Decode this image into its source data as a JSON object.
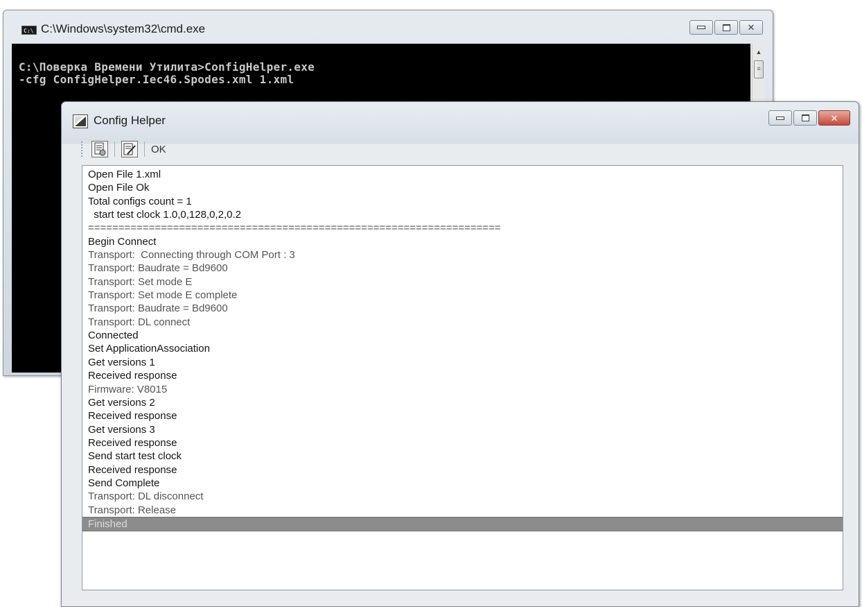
{
  "cmd_window": {
    "title": "C:\\Windows\\system32\\cmd.exe",
    "console_lines": [
      "C:\\Поверка Времени Утилита>ConfigHelper.exe",
      "-cfg ConfigHelper.Iec46.Spodes.xml 1.xml"
    ],
    "icon": "cmd-icon"
  },
  "config_helper": {
    "title": "Config Helper",
    "toolbar": {
      "button1_icon": "document-settings-icon",
      "button2_icon": "document-edit-icon",
      "ok_label": "OK"
    },
    "log": [
      {
        "text": "Open File 1.xml",
        "style": "normal"
      },
      {
        "text": "Open File Ok",
        "style": "normal"
      },
      {
        "text": "Total configs count = 1",
        "style": "normal"
      },
      {
        "text": "  start test clock 1.0,0,128,0,2,0.2",
        "style": "normal"
      },
      {
        "text": "====================================================================",
        "style": "dim"
      },
      {
        "text": "Begin Connect",
        "style": "normal"
      },
      {
        "text": "Transport:  Connecting through COM Port : 3",
        "style": "dim"
      },
      {
        "text": "Transport: Baudrate = Bd9600",
        "style": "dim"
      },
      {
        "text": "Transport: Set mode E",
        "style": "dim"
      },
      {
        "text": "Transport: Set mode E complete",
        "style": "dim"
      },
      {
        "text": "Transport: Baudrate = Bd9600",
        "style": "dim"
      },
      {
        "text": "Transport: DL connect",
        "style": "dim"
      },
      {
        "text": "Connected",
        "style": "normal"
      },
      {
        "text": "Set ApplicationAssociation",
        "style": "normal"
      },
      {
        "text": "Get versions 1",
        "style": "normal"
      },
      {
        "text": "Received response",
        "style": "normal"
      },
      {
        "text": "Firmware: V8015",
        "style": "dim"
      },
      {
        "text": "Get versions 2",
        "style": "normal"
      },
      {
        "text": "Received response",
        "style": "normal"
      },
      {
        "text": "Get versions 3",
        "style": "normal"
      },
      {
        "text": "Received response",
        "style": "normal"
      },
      {
        "text": "Send start test clock",
        "style": "normal"
      },
      {
        "text": "Received response",
        "style": "normal"
      },
      {
        "text": "Send Complete",
        "style": "normal"
      },
      {
        "text": "Transport: DL disconnect",
        "style": "dim"
      },
      {
        "text": "Transport: Release",
        "style": "dim"
      },
      {
        "text": "Finished",
        "style": "selected"
      }
    ]
  }
}
